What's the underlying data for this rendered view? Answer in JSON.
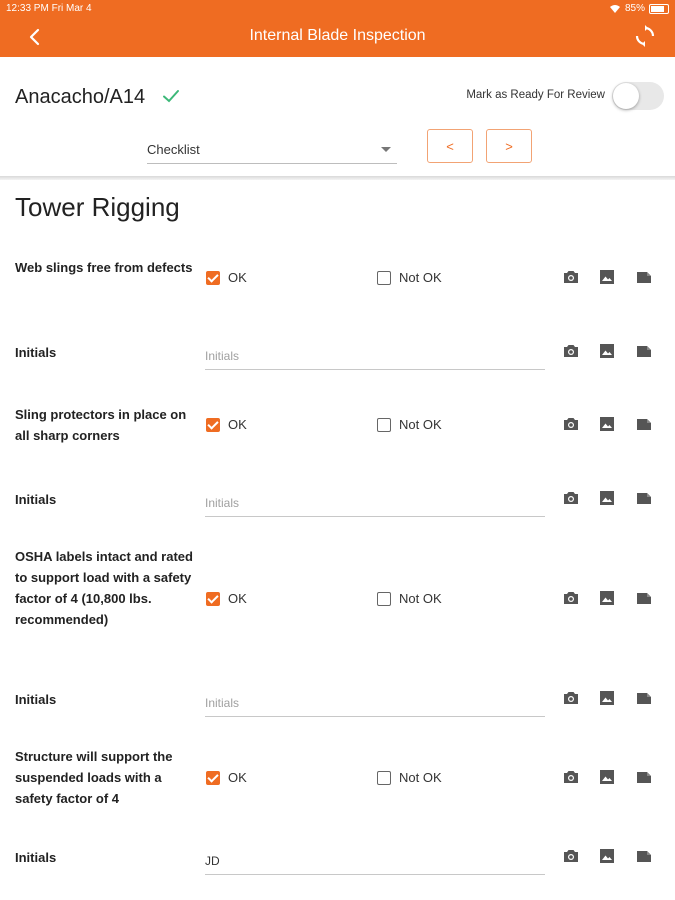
{
  "status_bar": {
    "time": "12:33 PM   Fri Mar 4",
    "battery": "85%"
  },
  "header": {
    "title": "Internal Blade Inspection"
  },
  "top": {
    "location": "Anacacho/A14",
    "review_label": "Mark as Ready For Review",
    "review_enabled": false,
    "dropdown_value": "Checklist",
    "prev_label": "<",
    "next_label": ">"
  },
  "section": {
    "title": "Tower Rigging"
  },
  "labels": {
    "ok": "OK",
    "not_ok": "Not OK",
    "initials": "Initials",
    "initials_placeholder": "Initials"
  },
  "items": [
    {
      "question": "Web slings free from defects",
      "ok_checked": true,
      "not_ok_checked": false,
      "initials_value": ""
    },
    {
      "question": "Sling protectors in place on all sharp corners",
      "ok_checked": true,
      "not_ok_checked": false,
      "initials_value": ""
    },
    {
      "question": "OSHA labels intact and rated to support load with a safety factor of 4 (10,800 lbs. recommended)",
      "ok_checked": true,
      "not_ok_checked": false,
      "initials_value": ""
    },
    {
      "question": "Structure will support the suspended loads with a safety factor of 4",
      "ok_checked": true,
      "not_ok_checked": false,
      "initials_value": "JD"
    }
  ],
  "colors": {
    "accent": "#ef6c22",
    "check_green": "#3cb878",
    "icon_gray": "#555555"
  },
  "icons": [
    "back-arrow-icon",
    "sync-icon",
    "checkmark-icon",
    "camera-icon",
    "image-icon",
    "note-icon"
  ]
}
